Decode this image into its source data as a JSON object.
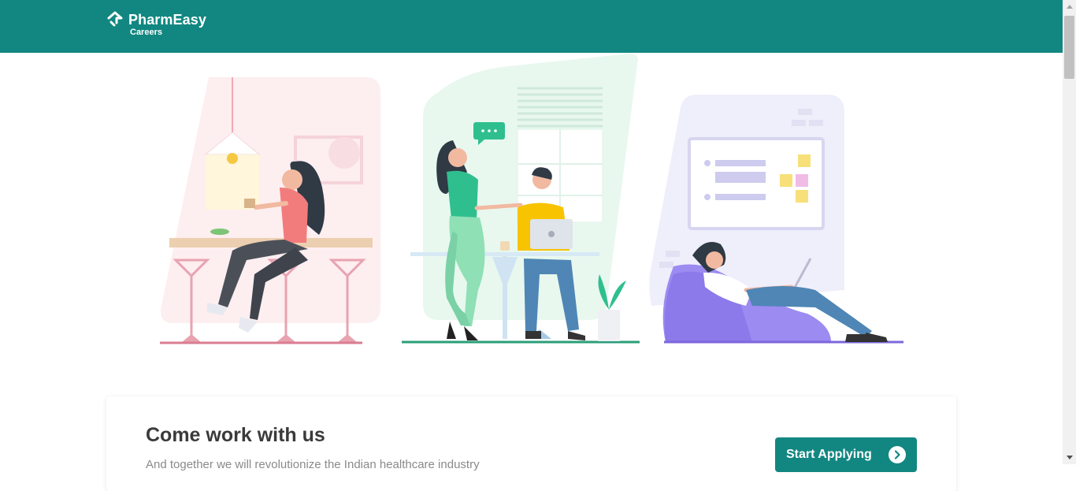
{
  "header": {
    "brand": "PharmEasy",
    "subtitle": "Careers",
    "background": "#128781"
  },
  "hero": {
    "illustration_icon": "office-team-illustration"
  },
  "cta_card": {
    "title": "Come work with us",
    "description": "And together we will revolutionize the Indian healthcare industry",
    "button_label": "Start Applying",
    "button_icon": "chevron-right-circle-icon",
    "accent": "#128781"
  }
}
